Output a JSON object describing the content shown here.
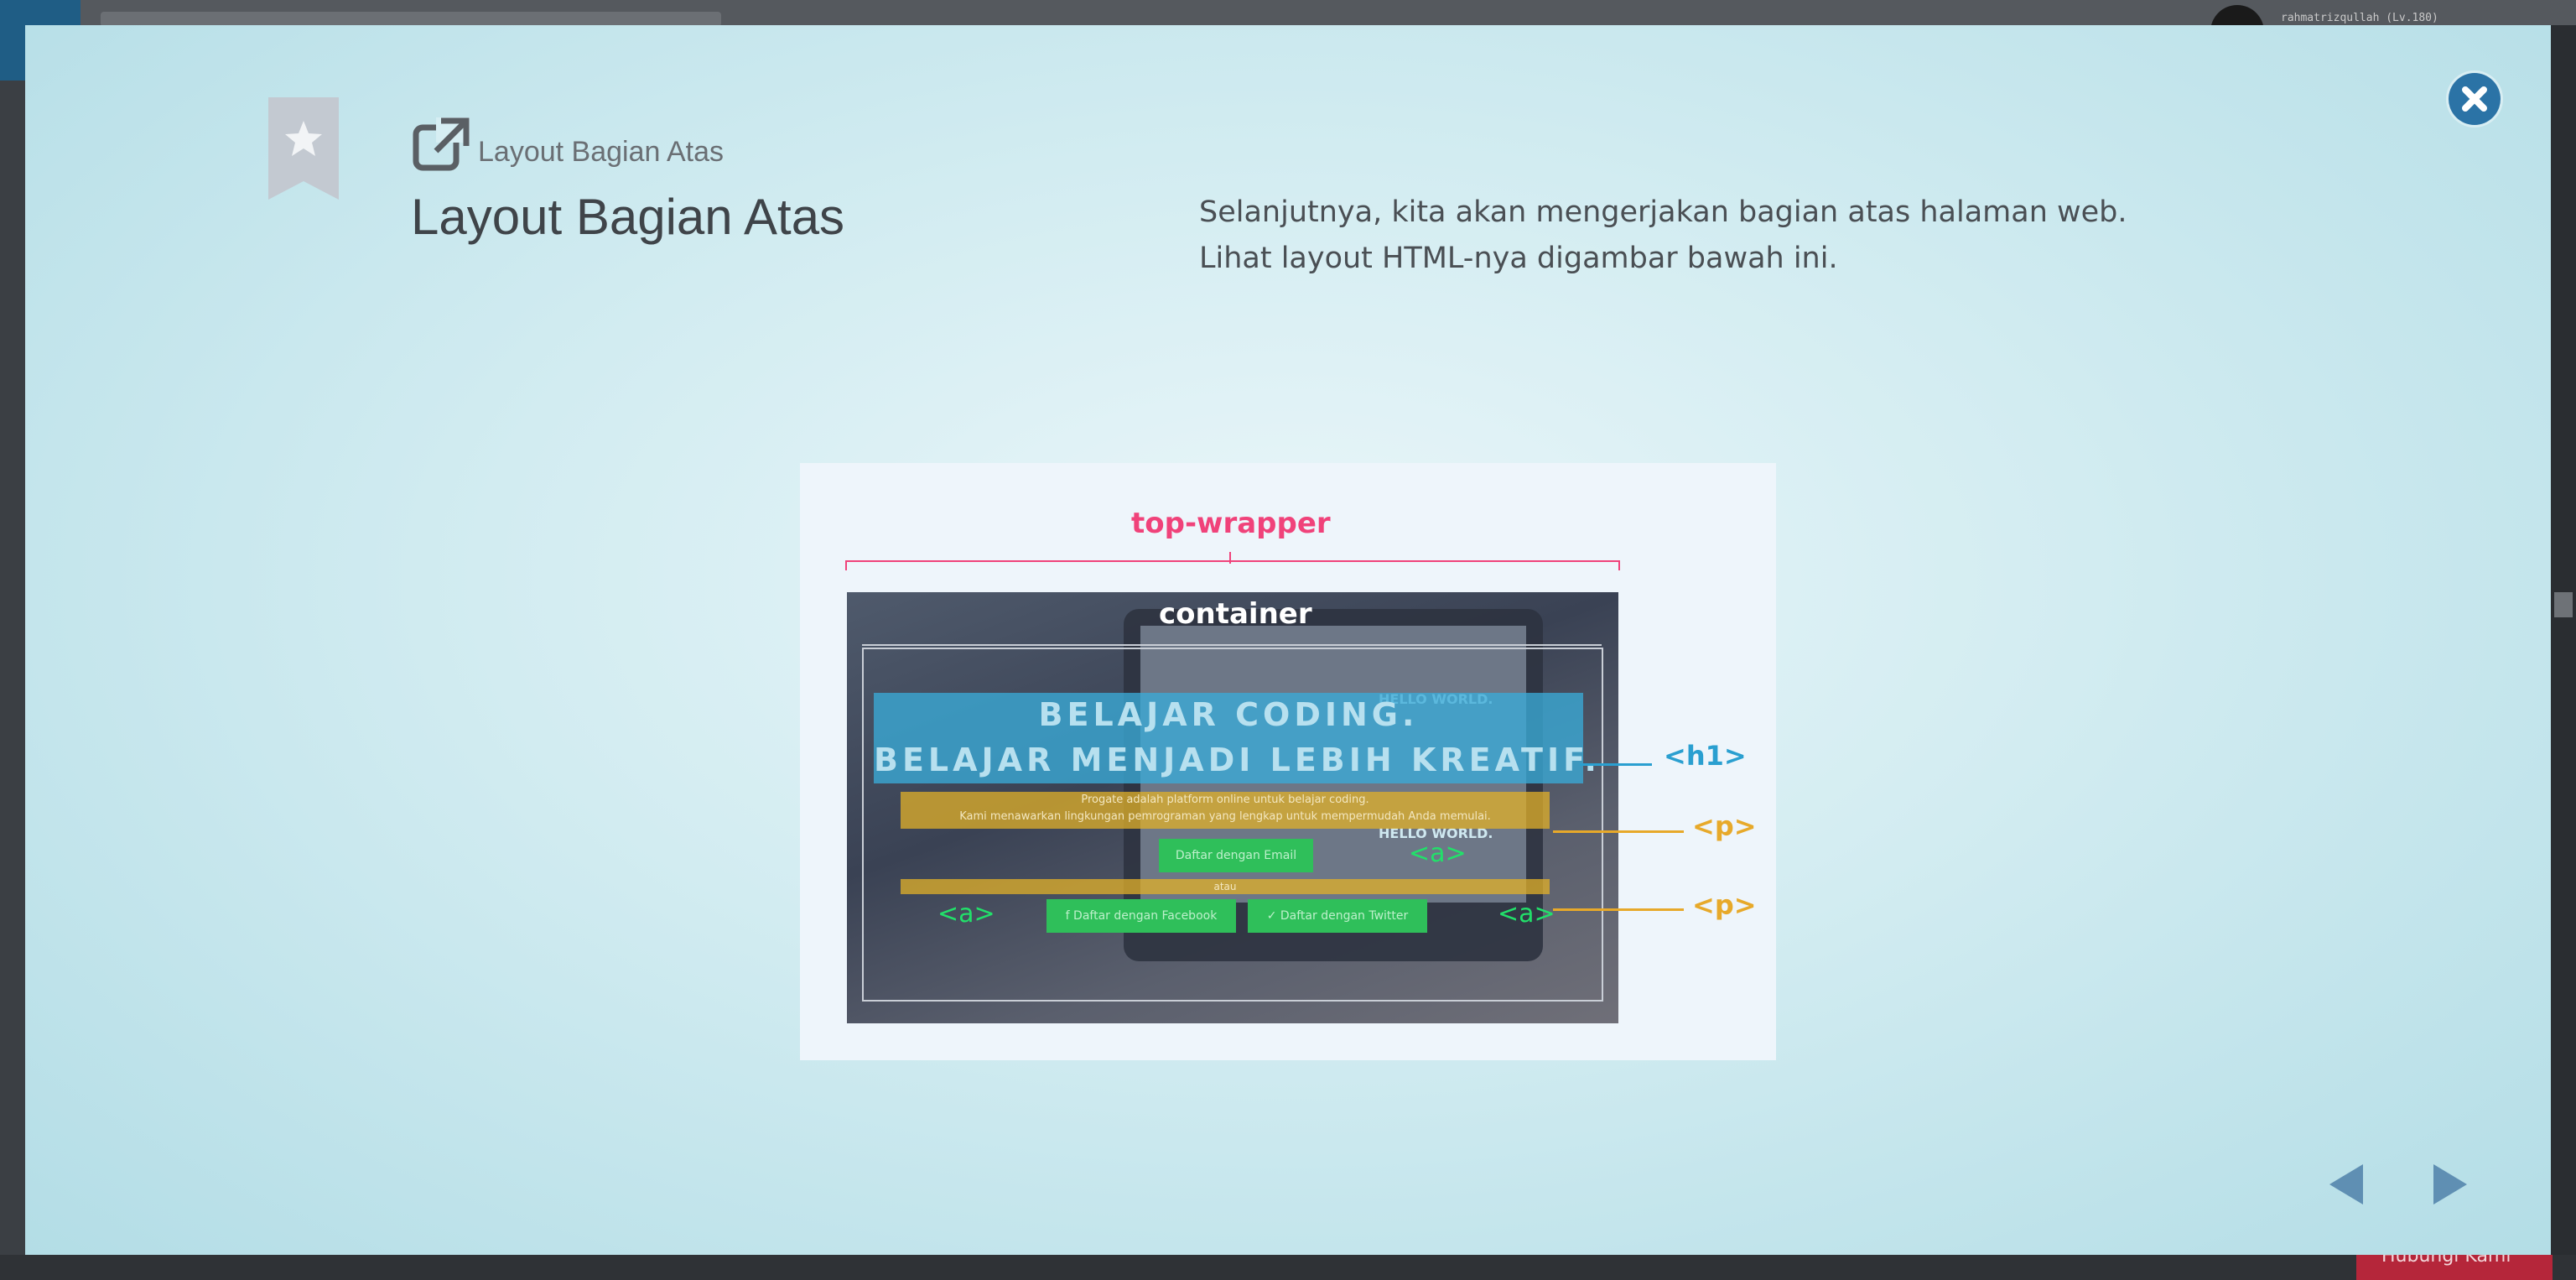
{
  "background": {
    "username": "rahmatrizqullah (Lv.180)",
    "bottom_button_label": "Hubungi Kami"
  },
  "modal": {
    "subtitle": "Layout Bagian Atas",
    "title": "Layout Bagian Atas",
    "description_line1": "Selanjutnya, kita akan mengerjakan bagian atas halaman web.",
    "description_line2": "Lihat layout HTML-nya digambar bawah ini.",
    "icons": {
      "bookmark": "bookmark-star-icon",
      "link": "external-link-icon",
      "close": "close-icon",
      "prev": "arrow-left-icon",
      "next": "arrow-right-icon"
    },
    "colors": {
      "accent": "#2b73a6",
      "nav_arrow": "#5f8fb3"
    }
  },
  "figure": {
    "label_wrapper": "top-wrapper",
    "label_container": "container",
    "h1_line1": "BELAJAR CODING.",
    "h1_line2": "BELAJAR MENJADI LEBIH KREATIF.",
    "p1_line1": "Progate adalah platform online untuk belajar coding.",
    "p1_line2": "Kami menawarkan lingkungan pemrograman yang lengkap untuk mempermudah Anda memulai.",
    "button_email": "Daftar dengan Email",
    "p2_text": "atau",
    "button_facebook": "f Daftar dengan Facebook",
    "button_twitter": "✓ Daftar dengan Twitter",
    "hello_text": "HELLO WORLD.",
    "label_h1": "<h1>",
    "label_p": "<p>",
    "label_a": "<a>",
    "colors": {
      "wrapper": "#f0427a",
      "h1": "#2a9fd0",
      "p": "#e7a92a",
      "a": "#22e06a"
    }
  }
}
